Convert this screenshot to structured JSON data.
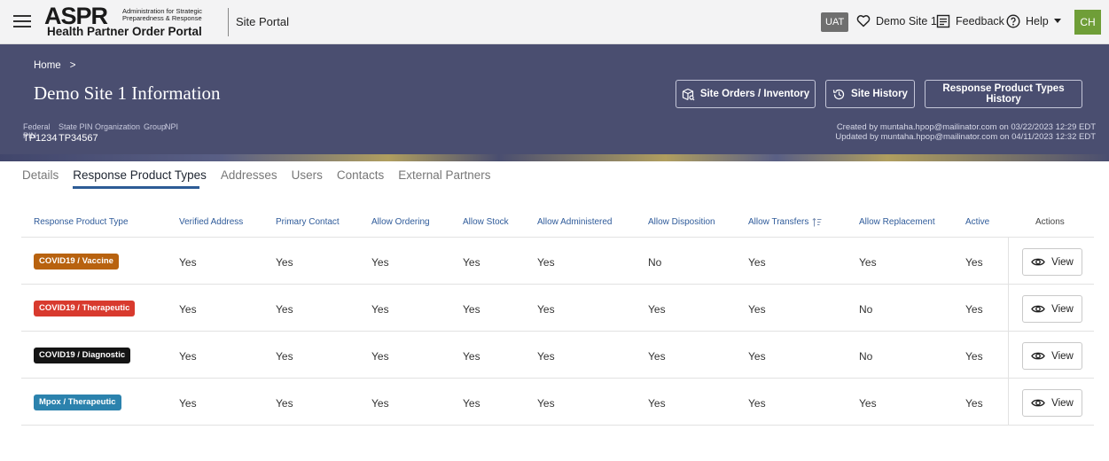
{
  "header": {
    "logo_aspr": "ASPR",
    "logo_subtitle": "Administration for Strategic Preparedness & Response",
    "logo_portal": "Health Partner Order Portal",
    "app_name": "Site Portal",
    "env_badge": "UAT",
    "site_label": "Demo Site 1",
    "feedback_label": "Feedback",
    "help_label": "Help",
    "avatar_initials": "CH"
  },
  "banner": {
    "breadcrumb_home": "Home",
    "breadcrumb_sep": ">",
    "title": "Demo Site 1 Information",
    "buttons": {
      "orders": "Site Orders / Inventory",
      "history": "Site History",
      "types_history": "Response Product Types History"
    },
    "meta": {
      "federal_pin_label": "Federal PIN",
      "federal_pin": "TP1234",
      "state_pin_label": "State PIN",
      "state_pin": "TP34567",
      "organization_label": "Organization",
      "group_label": "Group",
      "npi_label": "NPI"
    },
    "created": "Created by muntaha.hpop@mailinator.com on 03/22/2023 12:29 EDT",
    "updated": "Updated by muntaha.hpop@mailinator.com on 04/11/2023 12:32 EDT"
  },
  "tabs": [
    "Details",
    "Response Product Types",
    "Addresses",
    "Users",
    "Contacts",
    "External Partners"
  ],
  "active_tab": "Response Product Types",
  "table": {
    "headers": [
      "Response Product Type",
      "Verified Address",
      "Primary Contact",
      "Allow Ordering",
      "Allow Stock",
      "Allow Administered",
      "Allow Disposition",
      "Allow Transfers",
      "Allow Replacement",
      "Active",
      "Actions"
    ],
    "view_label": "View",
    "rows": [
      {
        "type": "COVID19 / Vaccine",
        "color": "#b8620f",
        "values": [
          "Yes",
          "Yes",
          "Yes",
          "Yes",
          "Yes",
          "No",
          "Yes",
          "Yes",
          "Yes"
        ]
      },
      {
        "type": "COVID19 / Therapeutic",
        "color": "#d83a2e",
        "values": [
          "Yes",
          "Yes",
          "Yes",
          "Yes",
          "Yes",
          "Yes",
          "Yes",
          "No",
          "Yes"
        ]
      },
      {
        "type": "COVID19 / Diagnostic",
        "color": "#141414",
        "values": [
          "Yes",
          "Yes",
          "Yes",
          "Yes",
          "Yes",
          "Yes",
          "Yes",
          "No",
          "Yes"
        ]
      },
      {
        "type": "Mpox / Therapeutic",
        "color": "#2b82ad",
        "values": [
          "Yes",
          "Yes",
          "Yes",
          "Yes",
          "Yes",
          "Yes",
          "Yes",
          "Yes",
          "Yes"
        ]
      }
    ]
  },
  "colors": {
    "banner_bg": "#4a4e70",
    "accent": "#2d5c96",
    "avatar_bg": "#6f9e38"
  }
}
